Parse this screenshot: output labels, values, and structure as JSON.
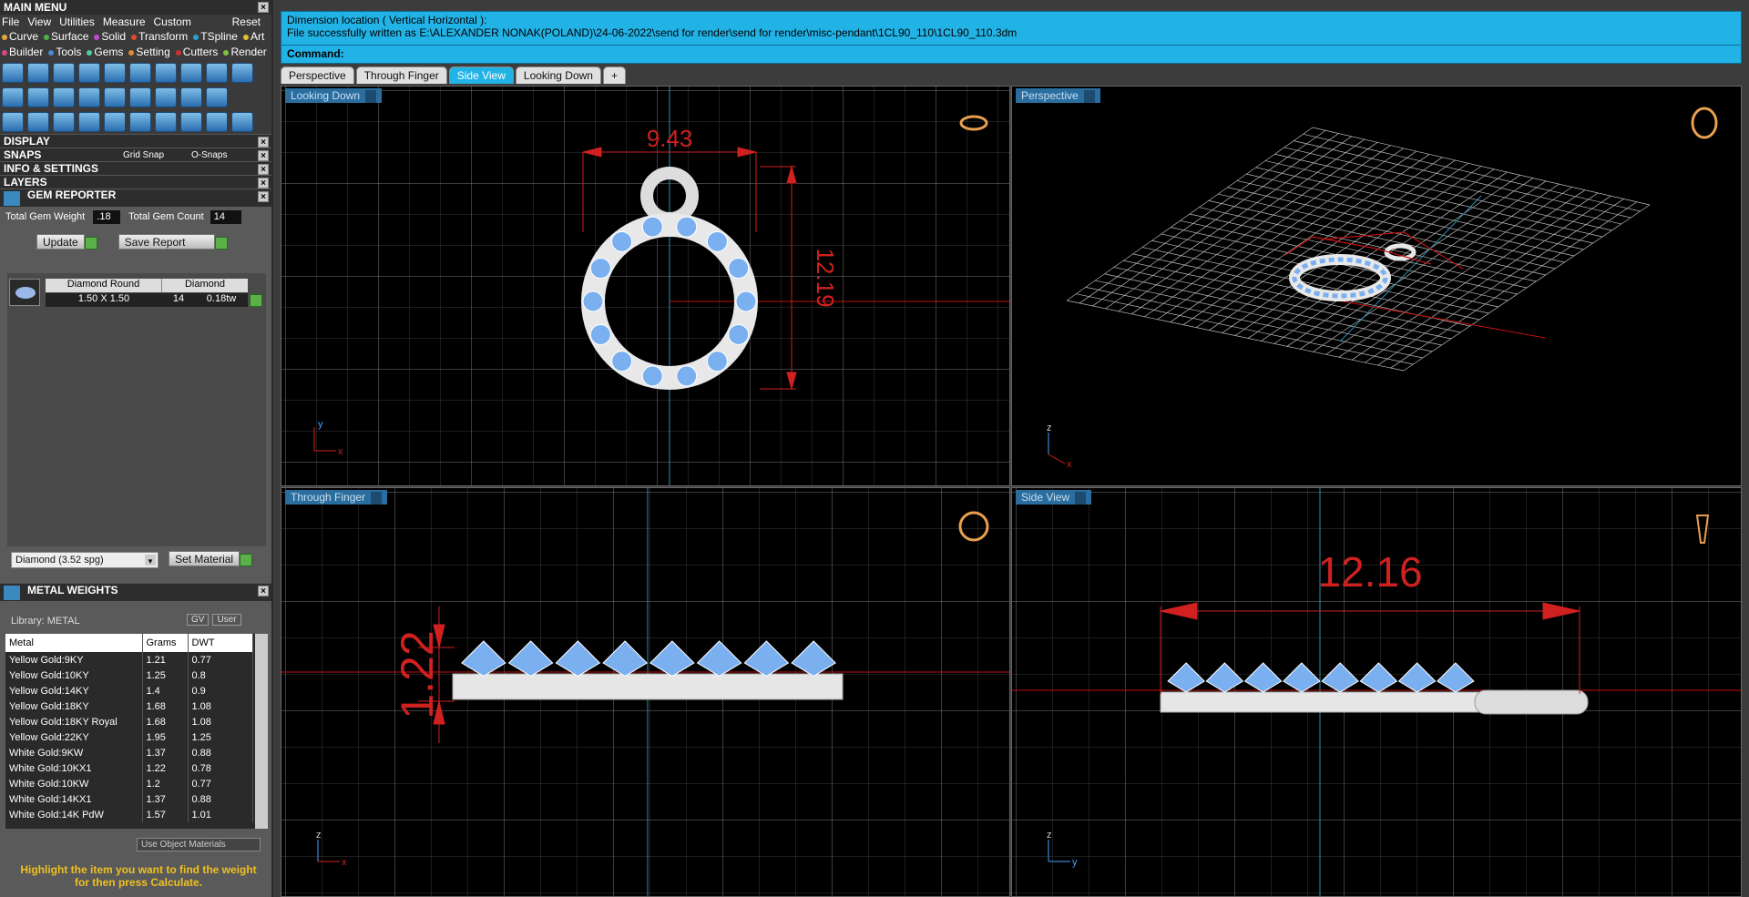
{
  "main_menu": {
    "title": "MAIN MENU",
    "menus": [
      "File",
      "View",
      "Utilities",
      "Measure",
      "Custom"
    ],
    "reset": "Reset",
    "tabs_row1": [
      {
        "label": "Curve",
        "color": "#e8a838"
      },
      {
        "label": "Surface",
        "color": "#4ab04a"
      },
      {
        "label": "Solid",
        "color": "#c04ad0"
      },
      {
        "label": "Transform",
        "color": "#e04a2a"
      },
      {
        "label": "TSpline",
        "color": "#28a0d0"
      },
      {
        "label": "Art",
        "color": "#e0c030"
      }
    ],
    "tabs_row2": [
      {
        "label": "Builder",
        "color": "#d04a8a"
      },
      {
        "label": "Tools",
        "color": "#4a8ad0"
      },
      {
        "label": "Gems",
        "color": "#4ad0a0"
      },
      {
        "label": "Setting",
        "color": "#e08a30"
      },
      {
        "label": "Cutters",
        "color": "#d03030"
      },
      {
        "label": "Render",
        "color": "#80c040"
      }
    ]
  },
  "panels": {
    "display": "DISPLAY",
    "snaps": "SNAPS",
    "grid_snap": "Grid Snap",
    "o_snaps": "O-Snaps",
    "info": "INFO & SETTINGS",
    "layers": "LAYERS"
  },
  "gem_reporter": {
    "title": "GEM REPORTER",
    "weight_label": "Total Gem Weight",
    "weight_value": ".18",
    "count_label": "Total Gem Count",
    "count_value": "14",
    "update": "Update",
    "save_report": "Save Report",
    "row_shape": "Diamond Round",
    "row_type": "Diamond",
    "row_size": "1.50 X 1.50",
    "row_count": "14",
    "row_weight": "0.18tw",
    "material_select": "Diamond    (3.52 spg)",
    "set_material": "Set Material"
  },
  "metal_weights": {
    "title": "METAL WEIGHTS",
    "library": "Library: METAL",
    "gv": "GV",
    "user": "User",
    "headers": [
      "Metal",
      "Grams",
      "DWT"
    ],
    "rows": [
      [
        "Yellow Gold:9KY",
        "1.21",
        "0.77"
      ],
      [
        "Yellow Gold:10KY",
        "1.25",
        "0.8"
      ],
      [
        "Yellow Gold:14KY",
        "1.4",
        "0.9"
      ],
      [
        "Yellow Gold:18KY",
        "1.68",
        "1.08"
      ],
      [
        "Yellow Gold:18KY Royal",
        "1.68",
        "1.08"
      ],
      [
        "Yellow Gold:22KY",
        "1.95",
        "1.25"
      ],
      [
        "White Gold:9KW",
        "1.37",
        "0.88"
      ],
      [
        "White Gold:10KX1",
        "1.22",
        "0.78"
      ],
      [
        "White Gold:10KW",
        "1.2",
        "0.77"
      ],
      [
        "White Gold:14KX1",
        "1.37",
        "0.88"
      ],
      [
        "White Gold:14K PdW",
        "1.57",
        "1.01"
      ]
    ],
    "use_object": "Use Object Materials",
    "hint": "Highlight the item you want to find the weight for then press Calculate."
  },
  "command": {
    "line1": "Dimension location ( Vertical  Horizontal ):",
    "line2": "File successfully written as E:\\ALEXANDER NONAK(POLAND)\\24-06-2022\\send for render\\send for render\\misc-pendant\\1CL90_110\\1CL90_110.3dm",
    "prompt": "Command:"
  },
  "view_tabs": [
    "Perspective",
    "Through Finger",
    "Side View",
    "Looking Down"
  ],
  "viewports": {
    "top_left": {
      "label": "Looking Down",
      "dim_w": "9.43",
      "dim_h": "12.19",
      "axis1": "y",
      "axis2": "x"
    },
    "top_right": {
      "label": "Perspective",
      "axis1": "z",
      "axis2": "x"
    },
    "bottom_left": {
      "label": "Through Finger",
      "dim_h": "1.22",
      "axis1": "z",
      "axis2": "x"
    },
    "bottom_right": {
      "label": "Side View",
      "dim_w": "12.16",
      "axis1": "z",
      "axis2": "y"
    }
  },
  "colors": {
    "accent": "#22b3e6",
    "dimension": "#e02020",
    "gem": "#7ab0f0",
    "metal": "#e8e8e8"
  }
}
